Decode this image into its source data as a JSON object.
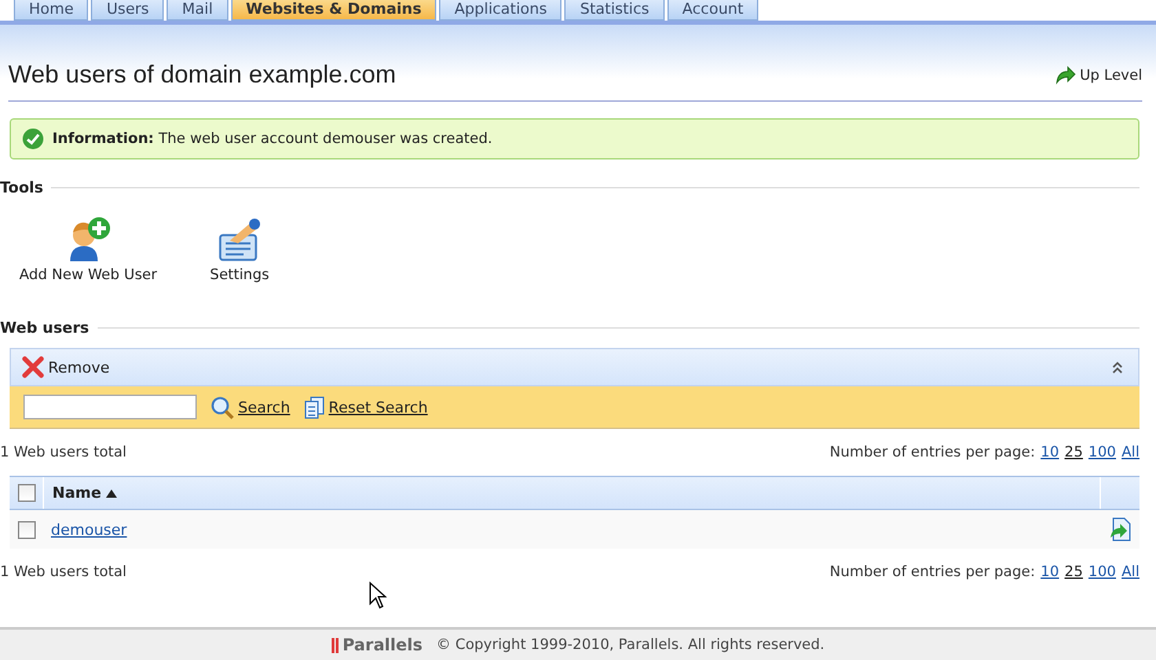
{
  "tabs": [
    {
      "label": "Home",
      "selected": false
    },
    {
      "label": "Users",
      "selected": false
    },
    {
      "label": "Mail",
      "selected": false
    },
    {
      "label": "Websites & Domains",
      "selected": true
    },
    {
      "label": "Applications",
      "selected": false
    },
    {
      "label": "Statistics",
      "selected": false
    },
    {
      "label": "Account",
      "selected": false
    }
  ],
  "header": {
    "title": "Web users of domain example.com",
    "up_level": "Up Level"
  },
  "message": {
    "label": "Information:",
    "text": "The web user account demouser was created."
  },
  "tools": {
    "heading": "Tools",
    "items": [
      {
        "label": "Add New Web User",
        "kind": "add-user"
      },
      {
        "label": "Settings",
        "kind": "settings"
      }
    ]
  },
  "web_users": {
    "heading": "Web users",
    "remove": "Remove",
    "search_button": "Search",
    "reset_button": "Reset Search",
    "total_top": "1 Web users total",
    "per_page_label_top": "Number of entries per page:",
    "per_page_top": [
      {
        "label": "10",
        "selected": false
      },
      {
        "label": "25",
        "selected": true
      },
      {
        "label": "100",
        "selected": false
      },
      {
        "label": "All",
        "selected": false
      }
    ],
    "select_all_checked": false,
    "columns": [
      {
        "label": "Name",
        "sorted_ascending": true
      }
    ],
    "rows": [
      {
        "name": "demouser",
        "checked": false
      }
    ],
    "total_bottom": "1 Web users total",
    "per_page_label_bottom": "Number of entries per page:",
    "per_page_bottom": [
      {
        "label": "10",
        "selected": false
      },
      {
        "label": "25",
        "selected": true
      },
      {
        "label": "100",
        "selected": false
      },
      {
        "label": "All",
        "selected": false
      }
    ]
  },
  "footer": {
    "brand": "Parallels",
    "copyright": "© Copyright 1999-2010, Parallels. All rights reserved."
  }
}
